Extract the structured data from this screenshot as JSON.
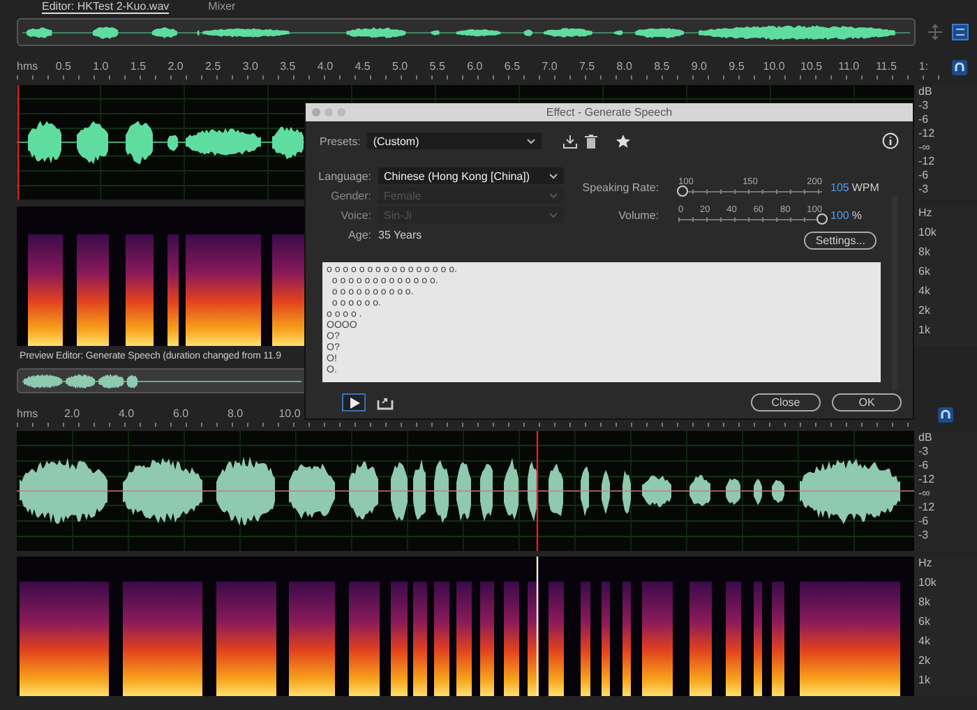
{
  "tabs": [
    {
      "label": "Editor: HKTest 2-Kuo.wav",
      "selected": true
    },
    {
      "label": "Mixer",
      "selected": false
    }
  ],
  "top_ruler": {
    "unit": "hms",
    "labels": [
      "0.5",
      "1.0",
      "1.5",
      "2.0",
      "2.5",
      "3.0",
      "3.5",
      "4.0",
      "4.5",
      "5.0",
      "5.5",
      "6.0",
      "6.5",
      "7.0",
      "7.5",
      "8.0",
      "8.5",
      "9.0",
      "9.5",
      "10.0",
      "10.5",
      "11.0",
      "11.5",
      "1:"
    ]
  },
  "top_db_scale": [
    "dB",
    "-3",
    "-6",
    "-12",
    "-∞",
    "-12",
    "-6",
    "-3"
  ],
  "top_hz_scale": [
    "Hz",
    "10k",
    "8k",
    "6k",
    "4k",
    "2k",
    "1k"
  ],
  "dialog": {
    "title": "Effect - Generate Speech",
    "presets": {
      "label": "Presets:",
      "value": "(Custom)"
    },
    "fields": [
      {
        "label": "Language:",
        "value": "Chinese (Hong Kong [China])",
        "disabled": false
      },
      {
        "label": "Gender:",
        "value": "Female",
        "disabled": true
      },
      {
        "label": "Voice:",
        "value": "Sin-Ji",
        "disabled": true
      }
    ],
    "age": {
      "label": "Age:",
      "value": "35 Years"
    },
    "sliders": [
      {
        "label": "Speaking Rate:",
        "ticks": [
          "100",
          "150",
          "200"
        ],
        "level": 0.03,
        "value": "105",
        "unit": "WPM"
      },
      {
        "label": "Volume:",
        "ticks": [
          "0",
          "20",
          "40",
          "60",
          "80",
          "100"
        ],
        "level": 1,
        "value": "100",
        "unit": "%"
      }
    ],
    "settings_button": "Settings...",
    "text_lines": [
      "o o o o o o o o o o o o o o o o.",
      "  o o o o o o o o o o o o o.",
      "  o o o o o o o o o o.",
      "  o o o o o o.",
      "o o o o .",
      "OOOO",
      "O?",
      "O?",
      "O!",
      "O."
    ],
    "buttons": [
      "Close",
      "OK"
    ]
  },
  "preview_label": "Preview Editor: Generate Speech (duration changed from 11.9",
  "bottom_ruler": {
    "unit": "hms",
    "labels": [
      "2.0",
      "4.0",
      "6.0",
      "8.0",
      "10.0"
    ]
  },
  "bottom_db_scale": [
    "dB",
    "-3",
    "-6",
    "-12",
    "-∞",
    "-12",
    "-6",
    "-3"
  ],
  "bottom_hz_scale": [
    "Hz",
    "10k",
    "8k",
    "6k",
    "4k",
    "2k",
    "1k"
  ]
}
